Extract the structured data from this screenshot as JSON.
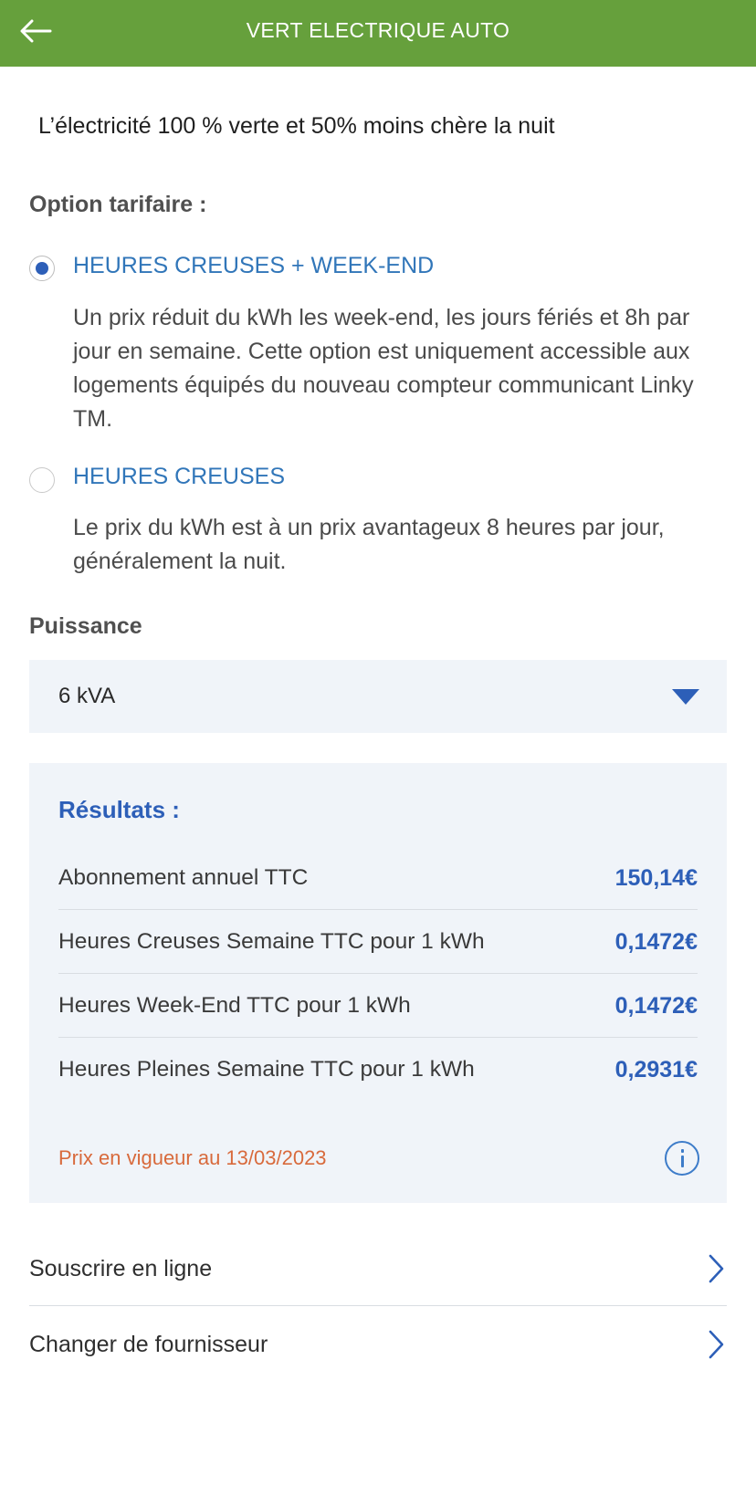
{
  "header": {
    "title": "VERT ELECTRIQUE AUTO"
  },
  "tagline": "L’électricité 100 % verte et 50% moins chère la nuit",
  "tariff": {
    "label": "Option tarifaire :",
    "options": [
      {
        "title": "HEURES CREUSES + WEEK-END",
        "description": "Un prix réduit du kWh les week-end, les jours fériés et 8h par jour en semaine. Cette option est uniquement accessible aux logements équipés du nouveau compteur communicant Linky TM.",
        "selected": true
      },
      {
        "title": "HEURES CREUSES",
        "description": "Le prix du kWh est à un prix avantageux 8 heures par jour, généralement la nuit.",
        "selected": false
      }
    ]
  },
  "power": {
    "label": "Puissance",
    "selected": "6 kVA"
  },
  "results": {
    "title": "Résultats :",
    "rows": [
      {
        "label": "Abonnement annuel TTC",
        "value": "150,14€"
      },
      {
        "label": "Heures Creuses Semaine TTC pour 1 kWh",
        "value": "0,1472€"
      },
      {
        "label": "Heures Week-End TTC pour 1 kWh",
        "value": "0,1472€"
      },
      {
        "label": "Heures Pleines Semaine TTC pour 1 kWh",
        "value": "0,2931€"
      }
    ],
    "price_date": "Prix en vigueur au 13/03/2023"
  },
  "links": [
    {
      "label": "Souscrire en ligne"
    },
    {
      "label": "Changer de fournisseur"
    }
  ],
  "colors": {
    "header_green": "#66a03c",
    "accent_blue": "#2d5fb8",
    "option_blue": "#3176b9",
    "date_orange": "#d86a3c",
    "panel_bg": "#f0f4f9"
  },
  "icons": {
    "back": "arrow-left-icon",
    "caret": "caret-down-icon",
    "info": "info-icon",
    "chevron": "chevron-right-icon"
  }
}
